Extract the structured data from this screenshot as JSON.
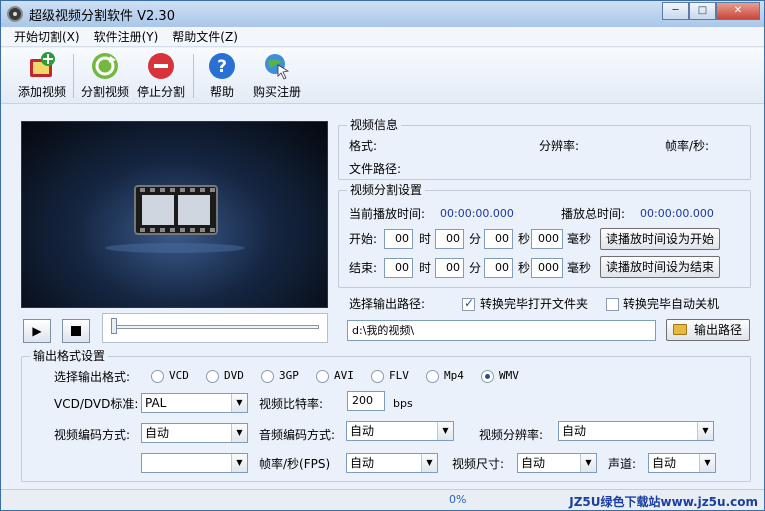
{
  "title": "超级视频分割软件 V2.30",
  "menu": [
    "开始切割(X)",
    "软件注册(Y)",
    "帮助文件(Z)"
  ],
  "toolbar": {
    "add": "添加视频",
    "split": "分割视频",
    "stop": "停止分割",
    "help": "帮助",
    "buy": "购买注册"
  },
  "video_info": {
    "title": "视频信息",
    "format_label": "格式:",
    "resolution_label": "分辨率:",
    "fps_label": "帧率/秒:",
    "path_label": "文件路径:"
  },
  "split_settings": {
    "title": "视频分割设置",
    "current_label": "当前播放时间:",
    "current_value": "00:00:00.000",
    "total_label": "播放总时间:",
    "total_value": "00:00:00.000",
    "start_label": "开始:",
    "end_label": "结束:",
    "hour": "时",
    "minute": "分",
    "second": "秒",
    "ms": "毫秒",
    "zero": "00",
    "zero_ms": "000",
    "set_start_button": "读播放时间设为开始",
    "set_end_button": "读播放时间设为结束"
  },
  "output": {
    "path_label": "选择输出路径:",
    "open_folder_label": "转换完毕打开文件夹",
    "open_folder_checked": true,
    "shutdown_label": "转换完毕自动关机",
    "shutdown_checked": false,
    "path_value": "d:\\我的视频\\",
    "path_button": "输出路径"
  },
  "format_settings": {
    "title": "输出格式设置",
    "format_label": "选择输出格式:",
    "formats": [
      "VCD",
      "DVD",
      "3GP",
      "AVI",
      "FLV",
      "Mp4",
      "WMV"
    ],
    "selected_format": "WMV",
    "standard_label": "VCD/DVD标准:",
    "standard_value": "PAL",
    "bitrate_label": "视频比特率:",
    "bitrate_value": "200",
    "bitrate_unit": "bps",
    "video_codec_label": "视频编码方式:",
    "video_codec_value": "自动",
    "audio_codec_label": "音频编码方式:",
    "audio_codec_value": "自动",
    "resolution_label": "视频分辨率:",
    "resolution_value": "自动",
    "fps_label": "帧率/秒(FPS)",
    "fps_value": "自动",
    "size_label": "视频尺寸:",
    "size_value": "自动",
    "channel_label": "声道:",
    "channel_value": "自动"
  },
  "status": {
    "progress_text": "0%",
    "watermark": "JZ5U绿色下载站www.jz5u.com"
  },
  "colors": {
    "time_value": "#1a3c9c",
    "progress": "#2a60b8"
  }
}
